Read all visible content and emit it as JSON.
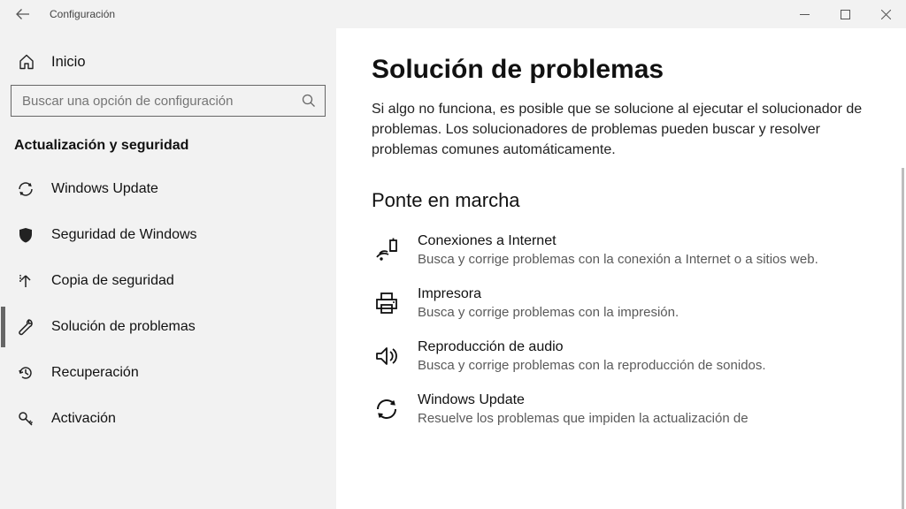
{
  "titlebar": {
    "app_title": "Configuración"
  },
  "sidebar": {
    "home_label": "Inicio",
    "search_placeholder": "Buscar una opción de configuración",
    "section_title": "Actualización y seguridad",
    "items": [
      {
        "label": "Windows Update",
        "icon": "sync",
        "selected": false
      },
      {
        "label": "Seguridad de Windows",
        "icon": "shield",
        "selected": false
      },
      {
        "label": "Copia de seguridad",
        "icon": "backup-arrow",
        "selected": false
      },
      {
        "label": "Solución de problemas",
        "icon": "wrench",
        "selected": true
      },
      {
        "label": "Recuperación",
        "icon": "history",
        "selected": false
      },
      {
        "label": "Activación",
        "icon": "key",
        "selected": false
      }
    ]
  },
  "main": {
    "page_title": "Solución de problemas",
    "intro": "Si algo no funciona, es posible que se solucione al ejecutar el solucionador de problemas. Los solucionadores de problemas pueden buscar y resolver problemas comunes automáticamente.",
    "section_title": "Ponte en marcha",
    "troubleshooters": [
      {
        "icon": "internet",
        "title": "Conexiones a Internet",
        "desc": "Busca y corrige problemas con la conexión a Internet o a sitios web."
      },
      {
        "icon": "printer",
        "title": "Impresora",
        "desc": "Busca y corrige problemas con la impresión."
      },
      {
        "icon": "audio",
        "title": "Reproducción de audio",
        "desc": "Busca y corrige problemas con la reproducción de sonidos."
      },
      {
        "icon": "sync",
        "title": "Windows Update",
        "desc": "Resuelve los problemas que impiden la actualización de"
      }
    ]
  }
}
